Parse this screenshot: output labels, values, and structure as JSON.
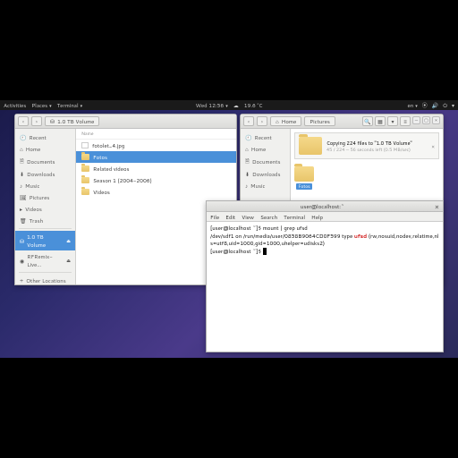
{
  "topbar": {
    "activities": "Activities",
    "places": "Places",
    "terminal": "Terminal",
    "clock": "Wed 12:56",
    "temp": "19.6 °C",
    "lang": "en"
  },
  "fw1": {
    "path": "1.0 TB Volume",
    "col": "Name",
    "sidebar": [
      {
        "icon": "🕘",
        "label": "Recent"
      },
      {
        "icon": "⌂",
        "label": "Home"
      },
      {
        "icon": "🗎",
        "label": "Documents"
      },
      {
        "icon": "⬇",
        "label": "Downloads"
      },
      {
        "icon": "♪",
        "label": "Music"
      },
      {
        "icon": "🖼",
        "label": "Pictures"
      },
      {
        "icon": "▸",
        "label": "Videos"
      },
      {
        "icon": "🗑",
        "label": "Trash"
      }
    ],
    "volume": "1.0 TB Volume",
    "remix": "RFRemix-Live...",
    "other": "Other Locations",
    "rows": [
      {
        "label": "fotolet_4.jpg",
        "type": "img",
        "sel": false
      },
      {
        "label": "Fotos",
        "type": "folder",
        "sel": true
      },
      {
        "label": "Related videos",
        "type": "folder",
        "sel": false
      },
      {
        "label": "Season 1 (2004-2006)",
        "type": "folder",
        "sel": false
      },
      {
        "label": "Videos",
        "type": "folder",
        "sel": false
      }
    ]
  },
  "fw2": {
    "home": "Home",
    "pictures": "Pictures",
    "sidebar": [
      {
        "icon": "🕘",
        "label": "Recent"
      },
      {
        "icon": "⌂",
        "label": "Home"
      },
      {
        "icon": "🗎",
        "label": "Documents"
      },
      {
        "icon": "⬇",
        "label": "Downloads"
      },
      {
        "icon": "♪",
        "label": "Music"
      }
    ],
    "copy_title": "Copying 224 files to \"1.0 TB Volume\"",
    "copy_sub": "45 / 224 — 56 seconds left (0.5 MB/sec)",
    "item_label": "Fotos"
  },
  "term": {
    "title": "user@localhost:~",
    "menu": [
      "File",
      "Edit",
      "View",
      "Search",
      "Terminal",
      "Help"
    ],
    "prompt1": "[user@localhost ~]$ ",
    "cmd": "mount | grep ufsd",
    "out1_a": "/dev/sdf1 on /run/media/user/0858B9064CD0F599 type ",
    "out1_b": "ufsd",
    "out1_c": " (rw,nosuid,nodev,relatime,nls=utf8,uid=1000,gid=1000,uhelper=udisks2)",
    "prompt2": "[user@localhost ~]$ "
  }
}
